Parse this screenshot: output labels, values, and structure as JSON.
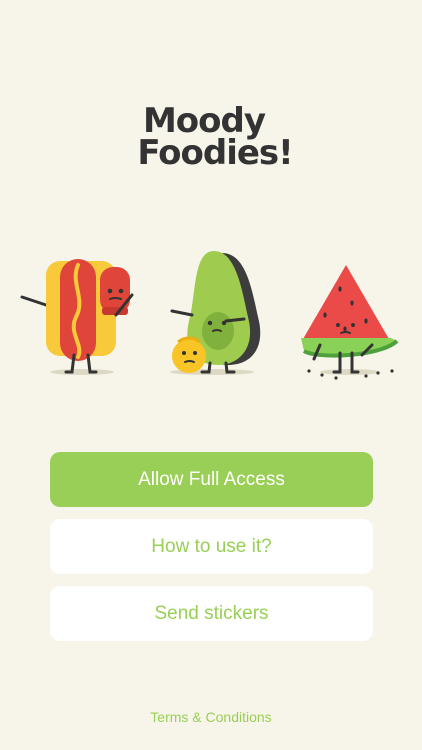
{
  "logo": {
    "line1": "Moody",
    "line2": "Foodies!"
  },
  "illustration": {
    "characters": [
      "hotdog-character-icon",
      "avocado-character-icon",
      "emoji-ball-icon",
      "watermelon-character-icon"
    ]
  },
  "buttons": {
    "allow_full_access": "Allow Full Access",
    "how_to_use": "How to use it?",
    "send_stickers": "Send stickers"
  },
  "footer": {
    "terms": "Terms & Conditions"
  },
  "colors": {
    "background": "#f7f5ea",
    "accent": "#99cf56",
    "logo_text": "#333333",
    "button_secondary_bg": "#ffffff"
  }
}
